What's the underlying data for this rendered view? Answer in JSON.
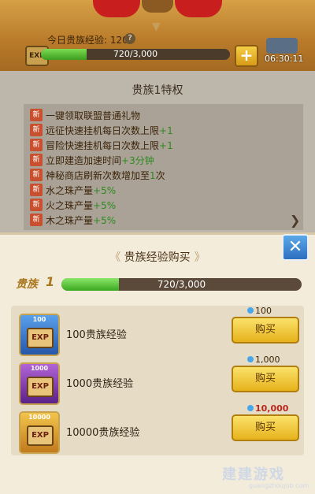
{
  "top": {
    "daily_label": "今日贵族经验: 120",
    "help": "?",
    "exp_badge": "EXP",
    "progress_text": "720/3,000",
    "progress_fraction": 0.24,
    "plus": "+",
    "timer": "06:30:11"
  },
  "privilege": {
    "title": "贵族1特权",
    "new_badge": "新",
    "items": [
      {
        "text": "一键领取联盟普通礼物",
        "highlight": ""
      },
      {
        "text": "远征快速挂机每日次数上限",
        "highlight": "+1"
      },
      {
        "text": "冒险快速挂机每日次数上限",
        "highlight": "+1"
      },
      {
        "text": "立即建造加速时间",
        "highlight": "+3分钟"
      },
      {
        "text": "神秘商店刷新次数增加至",
        "highlight": "1",
        "suffix": "次"
      },
      {
        "text": "水之珠产量",
        "highlight": "+5%"
      },
      {
        "text": "火之珠产量",
        "highlight": "+5%"
      },
      {
        "text": "木之珠产量",
        "highlight": "+5%"
      }
    ]
  },
  "modal": {
    "title": "贵族经验购买",
    "close": "✕",
    "noble_label": "贵族",
    "noble_level": "1",
    "progress_text": "720/3,000",
    "progress_fraction": 0.24,
    "exp_text": "EXP",
    "items": [
      {
        "icon_num": "100",
        "name": "100贵族经验",
        "price": "100",
        "price_color": "normal",
        "buy": "购买"
      },
      {
        "icon_num": "1000",
        "name": "1000贵族经验",
        "price": "1,000",
        "price_color": "normal",
        "buy": "购买"
      },
      {
        "icon_num": "10000",
        "name": "10000贵族经验",
        "price": "10,000",
        "price_color": "red",
        "buy": "购买"
      }
    ]
  },
  "watermark": {
    "main": "建建游戏",
    "sub": "guangzhoujob.com"
  }
}
